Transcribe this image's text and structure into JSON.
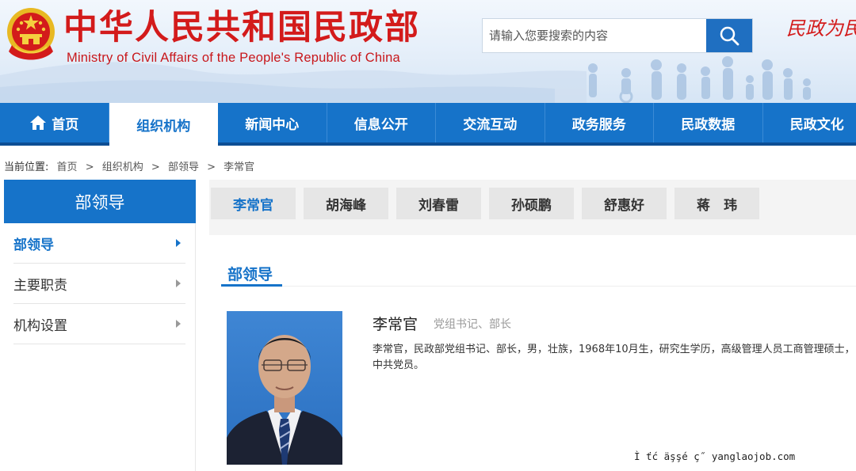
{
  "header": {
    "title_cn": "中华人民共和国民政部",
    "title_en": "Ministry of Civil Affairs of the People's Republic of China",
    "slogan": "民政为民",
    "search": {
      "placeholder": "请输入您要搜索的内容",
      "value": ""
    }
  },
  "nav": {
    "items": [
      {
        "label": "首页"
      },
      {
        "label": "组织机构",
        "active": true
      },
      {
        "label": "新闻中心"
      },
      {
        "label": "信息公开"
      },
      {
        "label": "交流互动"
      },
      {
        "label": "政务服务"
      },
      {
        "label": "民政数据"
      },
      {
        "label": "民政文化"
      }
    ]
  },
  "breadcrumb": {
    "prefix": "当前位置:",
    "items": [
      "首页",
      "组织机构",
      "部领导",
      "李常官"
    ],
    "separator": ">"
  },
  "sidebar": {
    "title": "部领导",
    "items": [
      {
        "label": "部领导",
        "active": true
      },
      {
        "label": "主要职责"
      },
      {
        "label": "机构设置"
      }
    ]
  },
  "tabs": [
    {
      "label": "李常官",
      "active": true
    },
    {
      "label": "胡海峰"
    },
    {
      "label": "刘春雷"
    },
    {
      "label": "孙硕鹏"
    },
    {
      "label": "舒惠好"
    },
    {
      "label": "蒋　玮"
    }
  ],
  "section": {
    "title": "部领导"
  },
  "profile": {
    "name": "李常官",
    "position": "党组书记、部长",
    "bio": "李常官，民政部党组书记、部长，男，壮族，1968年10月生，研究生学历，高级管理人员工商管理硕士，中共党员。"
  },
  "watermark": "Ì  ťć  äşşé  ç˝  yanglaojob.com",
  "colors": {
    "brand_blue": "#1673c9",
    "brand_red": "#d31b1b",
    "nav_border": "#0d4e94"
  }
}
